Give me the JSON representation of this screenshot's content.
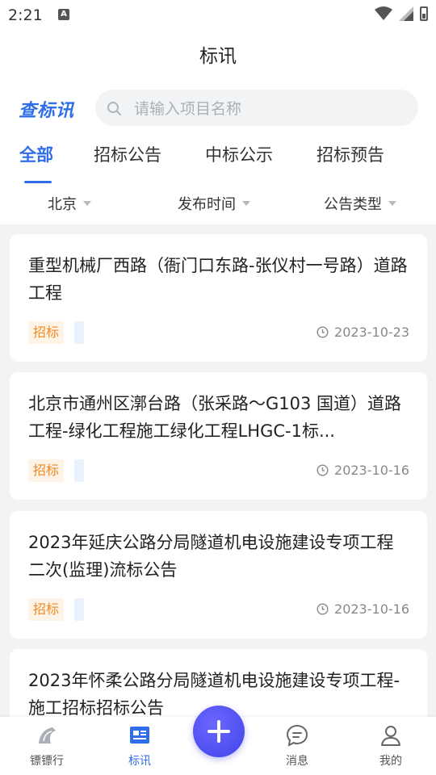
{
  "status_bar": {
    "time": "2:21",
    "notification_badge": "A"
  },
  "nav": {
    "title": "标讯"
  },
  "search": {
    "logo_text": "查标讯",
    "placeholder": "请输入项目名称"
  },
  "tabs": [
    {
      "label": "全部",
      "active": true
    },
    {
      "label": "招标公告",
      "active": false
    },
    {
      "label": "中标公示",
      "active": false
    },
    {
      "label": "招标预告",
      "active": false
    }
  ],
  "filters": {
    "region": "北京",
    "time": "发布时间",
    "type": "公告类型"
  },
  "cards": [
    {
      "title": "重型机械厂西路（衙门口东路-张仪村一号路）道路工程",
      "tag": "招标",
      "date": "2023-10-23"
    },
    {
      "title": "北京市通州区漷台路（张采路～G103 国道）道路工程-绿化工程施工绿化工程LHGC-1标...",
      "tag": "招标",
      "date": "2023-10-16"
    },
    {
      "title": "2023年延庆公路分局隧道机电设施建设专项工程二次(监理)流标公告",
      "tag": "招标",
      "date": "2023-10-16"
    },
    {
      "title": "2023年怀柔公路分局隧道机电设施建设专项工程-施工招标招标公告",
      "tag": "",
      "date": ""
    }
  ],
  "bottom_nav": [
    {
      "label": "镖镖行",
      "icon": "horse-icon",
      "active": false
    },
    {
      "label": "标讯",
      "icon": "news-icon",
      "active": true
    },
    {
      "label": "消息",
      "icon": "chat-icon",
      "active": false
    },
    {
      "label": "我的",
      "icon": "user-icon",
      "active": false
    }
  ],
  "colors": {
    "accent": "#2f6ee8",
    "tag_text": "#f08a24",
    "tag_bg": "#fdf3e6",
    "fab": "#4a4ff0"
  }
}
